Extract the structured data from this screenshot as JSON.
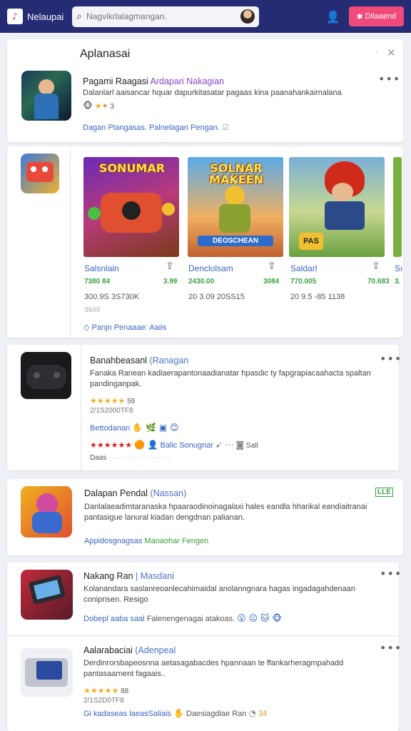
{
  "topbar": {
    "logo_text": "Nelaupai",
    "search_placeholder": "Nagvikrlalagmangan.",
    "cta_label": "Dilaaend",
    "colors": {
      "bar": "#262c74",
      "cta": "#f04a7a"
    }
  },
  "section1": {
    "header": "Aplanasai",
    "app": {
      "title": "Pagami Raagasi",
      "tag": "Ardapari Nakagian",
      "desc": "Dalanlarl aaisancar hquar dapurkitasatar pagaas kina paanahankaimalana",
      "rating": "3",
      "link": "Dagan Plangasas. Palnelagan Pengan."
    }
  },
  "carousel": {
    "link": "Panjn Penaaae: Aaiis",
    "items": [
      {
        "art_title": "SONUMAR",
        "art_sub": "",
        "name": "Salsnlain",
        "price": "3.99",
        "stat": "7380 84",
        "sub1": "300.9S 3S730K",
        "sub2": "3949"
      },
      {
        "art_title": "SOLNAR MAKEEN",
        "art_sub": "DEOSCHEAN",
        "name": "Denclolsam",
        "price": "3084",
        "stat": "2430.00",
        "sub1": "20 3.09 20SS15",
        "sub2": ""
      },
      {
        "art_title": "",
        "art_sub": "PAS",
        "name": "Saldarl",
        "price": "70.683",
        "stat": "770.005",
        "sub1": "20 9.5 -85 1138",
        "sub2": ""
      }
    ],
    "peek": {
      "name": "Sı",
      "price": "3."
    }
  },
  "app3": {
    "title": "Banahbeasanl",
    "tag": "Ranagan",
    "desc": "Fanaka Ranean kadiaerapantonaadianatar hpasdic ty fapgrapiacaahacta spaltan pandinganpak.",
    "rating": "59",
    "sub": "2/1S2000TF8",
    "link": "Bettodanan",
    "link2": "Balic Sonugnar",
    "stat": "Sall",
    "footer": "Daas"
  },
  "app4": {
    "title": "Dalapan Pendal",
    "tag": "Nassan",
    "badge": "LLE",
    "desc": "Danlalaeadimtaranaska hpaaraodinoinagalaxi hales eandla hharikal eandiaitranai pantasigue lanural kiadan dengdnan palianan.",
    "link": "Appidosgnagsas",
    "link2": "Manaohar Fengen"
  },
  "app5": {
    "title": "Nakang Ran",
    "tag": "Masdani",
    "desc": "Kolanandara saslanreoanlecahimaidal anolanngnara hagas ingadagahdenaan coniprisen. Resigo",
    "link": "Dobepl aaba saal",
    "link2": "Falenengenagai atakoas."
  },
  "app6": {
    "title": "Aalarabaciai",
    "tag": "Adenpeal",
    "desc": "Derdinrorsbapeosnna aetasagabacdes hpannaan te ffankarheragmpahadd pantasaarnent fagaais..",
    "rating": "88",
    "sub": "2/1S2D0TF8",
    "link": "Gi kadaseas laeasSaliais",
    "link2": "Daesiagdiae Ran",
    "stat": "34"
  }
}
